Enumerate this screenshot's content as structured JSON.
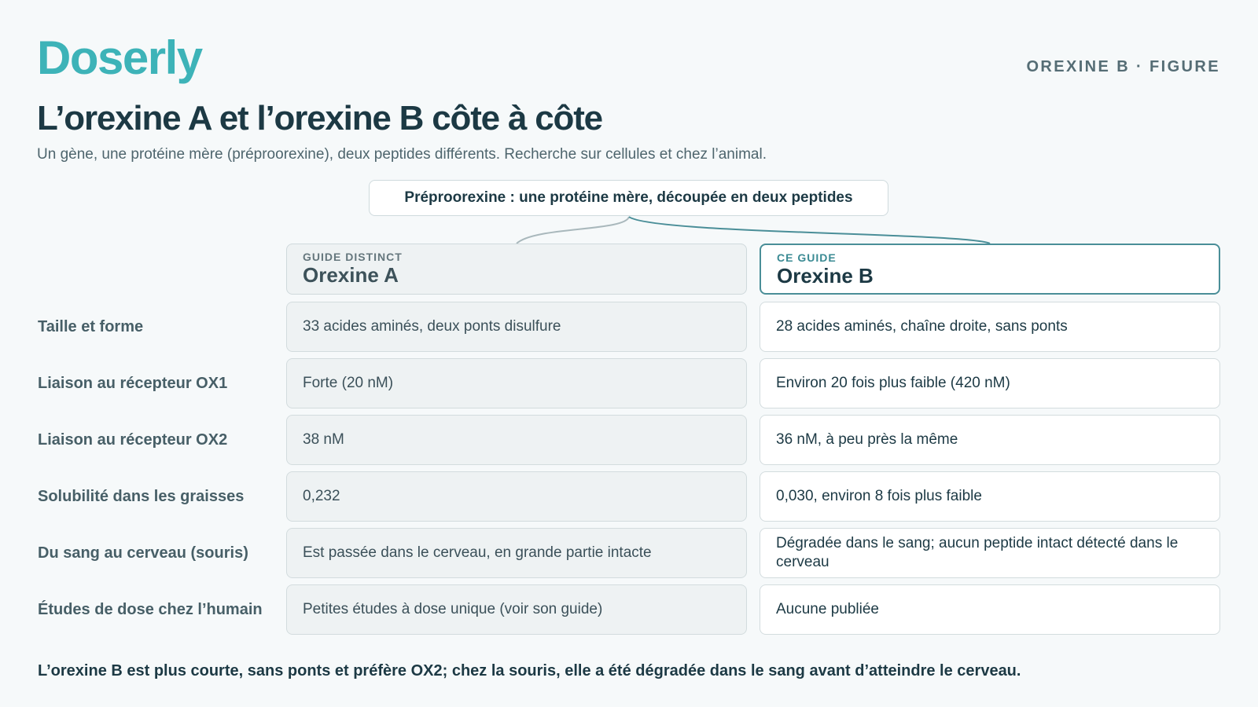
{
  "brand": {
    "logo": "Doserly",
    "figure_tag": "OREXINE B · FIGURE",
    "accent_color": "#3db3b8"
  },
  "header": {
    "title": "L’orexine A et l’orexine B côte à côte",
    "subtitle": "Un gène, une protéine mère (préproorexine), deux peptides différents. Recherche sur cellules et chez l’animal."
  },
  "parent": {
    "label": "Préproorexine : une protéine mère, découpée en deux peptides"
  },
  "columns": [
    {
      "kicker": "GUIDE DISTINCT",
      "name": "Orexine A"
    },
    {
      "kicker": "CE GUIDE",
      "name": "Orexine B"
    }
  ],
  "rows": [
    {
      "label": "Taille et forme",
      "a": "33 acides aminés, deux ponts disulfure",
      "b": "28 acides aminés, chaîne droite, sans ponts"
    },
    {
      "label": "Liaison au récepteur OX1",
      "a": "Forte (20 nM)",
      "b": "Environ 20 fois plus faible (420 nM)"
    },
    {
      "label": "Liaison au récepteur OX2",
      "a": "38 nM",
      "b": "36 nM, à peu près la même"
    },
    {
      "label": "Solubilité dans les graisses",
      "a": "0,232",
      "b": "0,030, environ 8 fois plus faible"
    },
    {
      "label": "Du sang au cerveau (souris)",
      "a": "Est passée dans le cerveau, en grande partie intacte",
      "b": "Dégradée dans le sang; aucun peptide intact détecté dans le cerveau"
    },
    {
      "label": "Études de dose chez l’humain",
      "a": "Petites études à dose unique (voir son guide)",
      "b": "Aucune publiée"
    }
  ],
  "conclusion": "L’orexine B est plus courte, sans ponts et préfère OX2; chez la souris, elle a été dégradée dans le sang avant d’atteindre le cerveau."
}
